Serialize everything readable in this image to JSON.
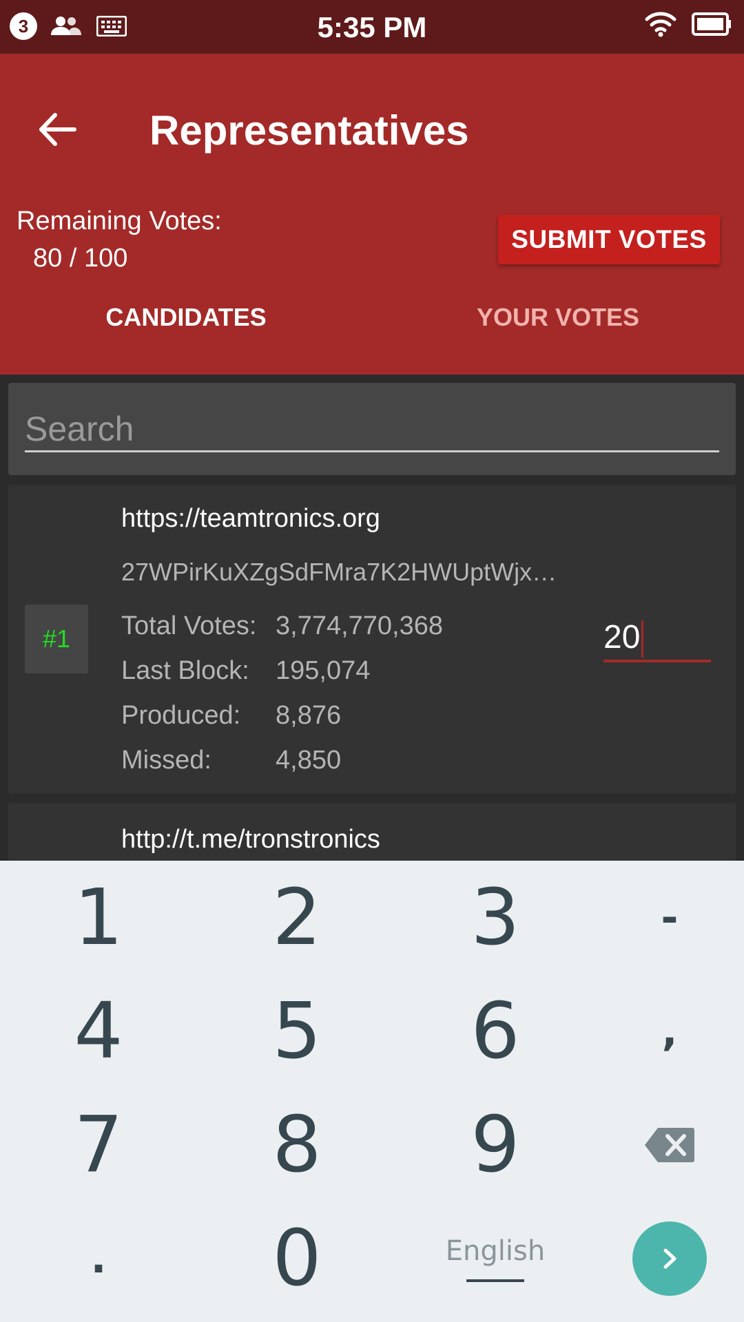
{
  "status_bar": {
    "notification_count": "3",
    "time": "5:35 PM"
  },
  "app_bar": {
    "title": "Representatives",
    "remaining_label": "Remaining Votes:",
    "remaining_value": "80 / 100",
    "submit_label": "SUBMIT VOTES"
  },
  "tabs": [
    {
      "label": "CANDIDATES",
      "selected": true
    },
    {
      "label": "YOUR VOTES",
      "selected": false
    }
  ],
  "search": {
    "placeholder": "Search"
  },
  "candidates": [
    {
      "url": "https://teamtronics.org",
      "address": "27WPirKuXZgSdFMra7K2HWUptWjx…",
      "rank": "#1",
      "stats": [
        {
          "label": "Total Votes:",
          "value": "3,774,770,368"
        },
        {
          "label": "Last Block:",
          "value": "195,074"
        },
        {
          "label": "Produced:",
          "value": "8,876"
        },
        {
          "label": "Missed:",
          "value": "4,850"
        }
      ],
      "vote_value": "20"
    },
    {
      "url": "http://t.me/tronstronics"
    }
  ],
  "keyboard": {
    "keys": [
      "1",
      "2",
      "3",
      "-",
      "4",
      "5",
      "6",
      ",",
      "7",
      "8",
      "9",
      "backspace",
      ".",
      "0",
      "English",
      "go"
    ],
    "language": "English"
  },
  "colors": {
    "status_bar": "#5e1a1a",
    "app_bar": "#a32a28",
    "submit_button": "#c4201e",
    "rank_text": "#22dd22",
    "go_button": "#4db6ac"
  }
}
